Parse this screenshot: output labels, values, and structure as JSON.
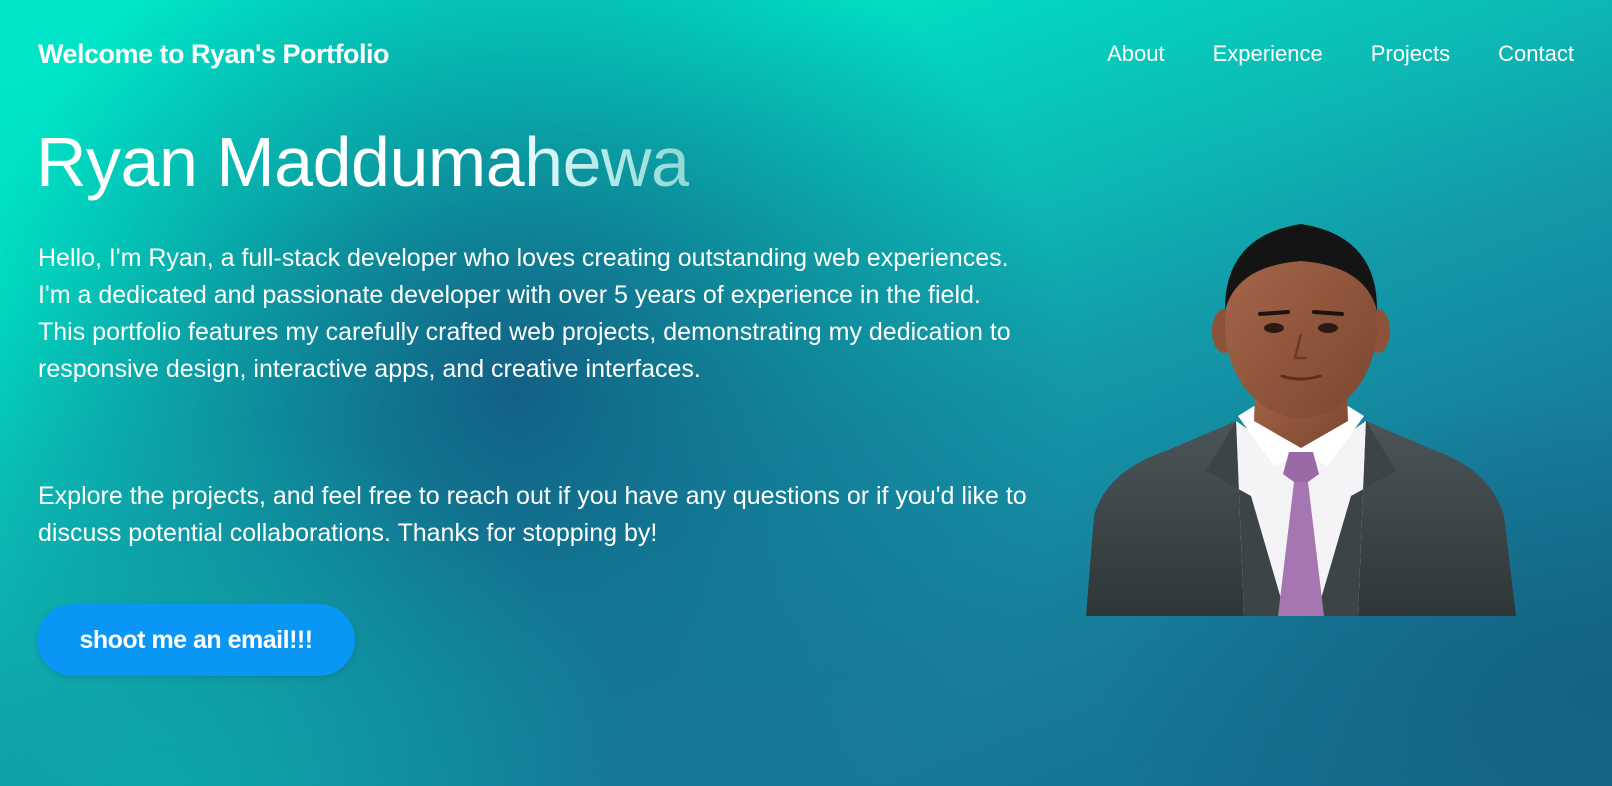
{
  "nav": {
    "brand": "Welcome to Ryan's Portfolio",
    "links": [
      "About",
      "Experience",
      "Projects",
      "Contact"
    ]
  },
  "hero": {
    "name_main": "Ryan Madduma",
    "name_faded": "hewa",
    "bio_paragraph_1": "Hello, I'm Ryan, a full-stack developer who loves creating outstanding web experiences. I'm a dedicated and passionate developer with over 5 years of experience in the field. This portfolio features my carefully crafted web projects, demonstrating my dedication to responsive design, interactive apps, and creative interfaces.",
    "bio_paragraph_2": "Explore the projects, and feel free to reach out if you have any questions or if you'd like to discuss potential collaborations. Thanks for stopping by!",
    "cta_label": "shoot me an email!!!"
  },
  "colors": {
    "accent_button": "#0a96f5",
    "background_top": "#00e6c8",
    "background_deep": "#176a8c"
  }
}
